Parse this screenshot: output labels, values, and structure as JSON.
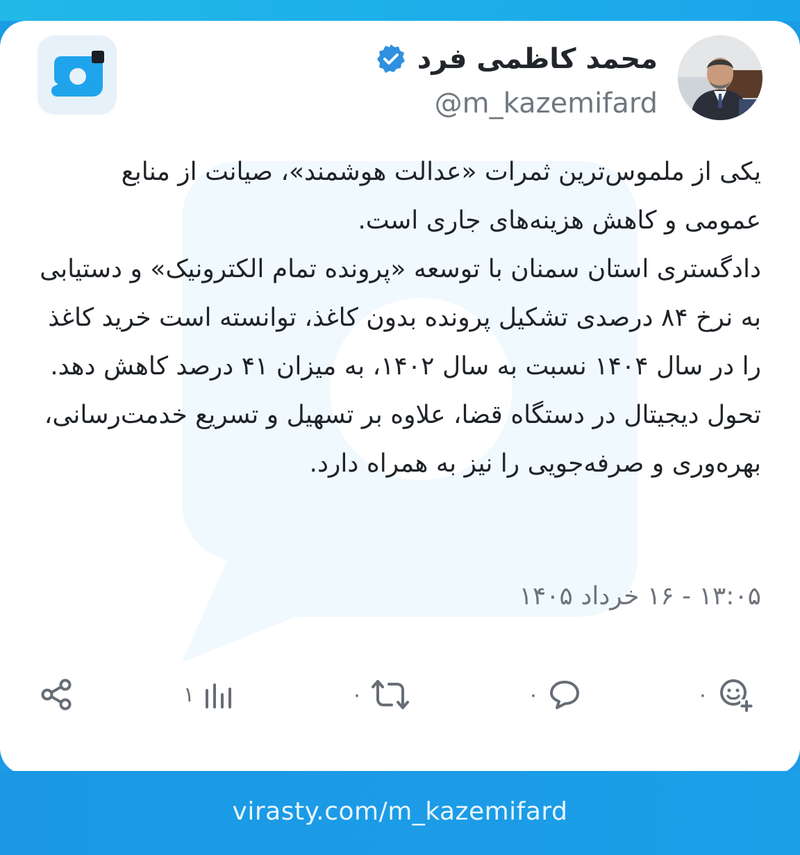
{
  "colors": {
    "brand": "#1d9fe8",
    "verified": "#2f8fe0",
    "text": "#1f2328",
    "muted": "#6f7780"
  },
  "author": {
    "name": "محمد کاظمی فرد",
    "handle": "@m_kazemifard",
    "verified": true
  },
  "post": {
    "paragraphs": [
      "یکی از ملموس‌ترین ثمرات «عدالت هوشمند»، صیانت از منابع عمومی و کاهش هزینه‌های جاری است.",
      "دادگستری استان سمنان با توسعه «پرونده تمام الکترونیک» و دستیابی به نرخ ۸۴ درصدی تشکیل پرونده بدون کاغذ، توانسته است خرید کاغذ را در سال ۱۴۰۴ نسبت به سال ۱۴۰۲، به میزان ۴۱ درصد کاهش دهد.",
      "تحول دیجیتال در دستگاه قضا، علاوه بر تسهیل و تسریع خدمت‌رسانی، بهره‌وری و صرفه‌جویی را نیز به همراه دارد."
    ],
    "date": "۱۳:۰۵ - ۱۶ خرداد ۱۴۰۵"
  },
  "actions": {
    "reactions": {
      "icon": "add-reaction-icon",
      "count": "۰"
    },
    "comments": {
      "icon": "comment-icon",
      "count": "۰"
    },
    "reposts": {
      "icon": "repost-icon",
      "count": "۰"
    },
    "views": {
      "icon": "views-icon",
      "count": "۱"
    },
    "share": {
      "icon": "share-icon"
    }
  },
  "footer": {
    "url": "virasty.com/m_kazemifard"
  }
}
